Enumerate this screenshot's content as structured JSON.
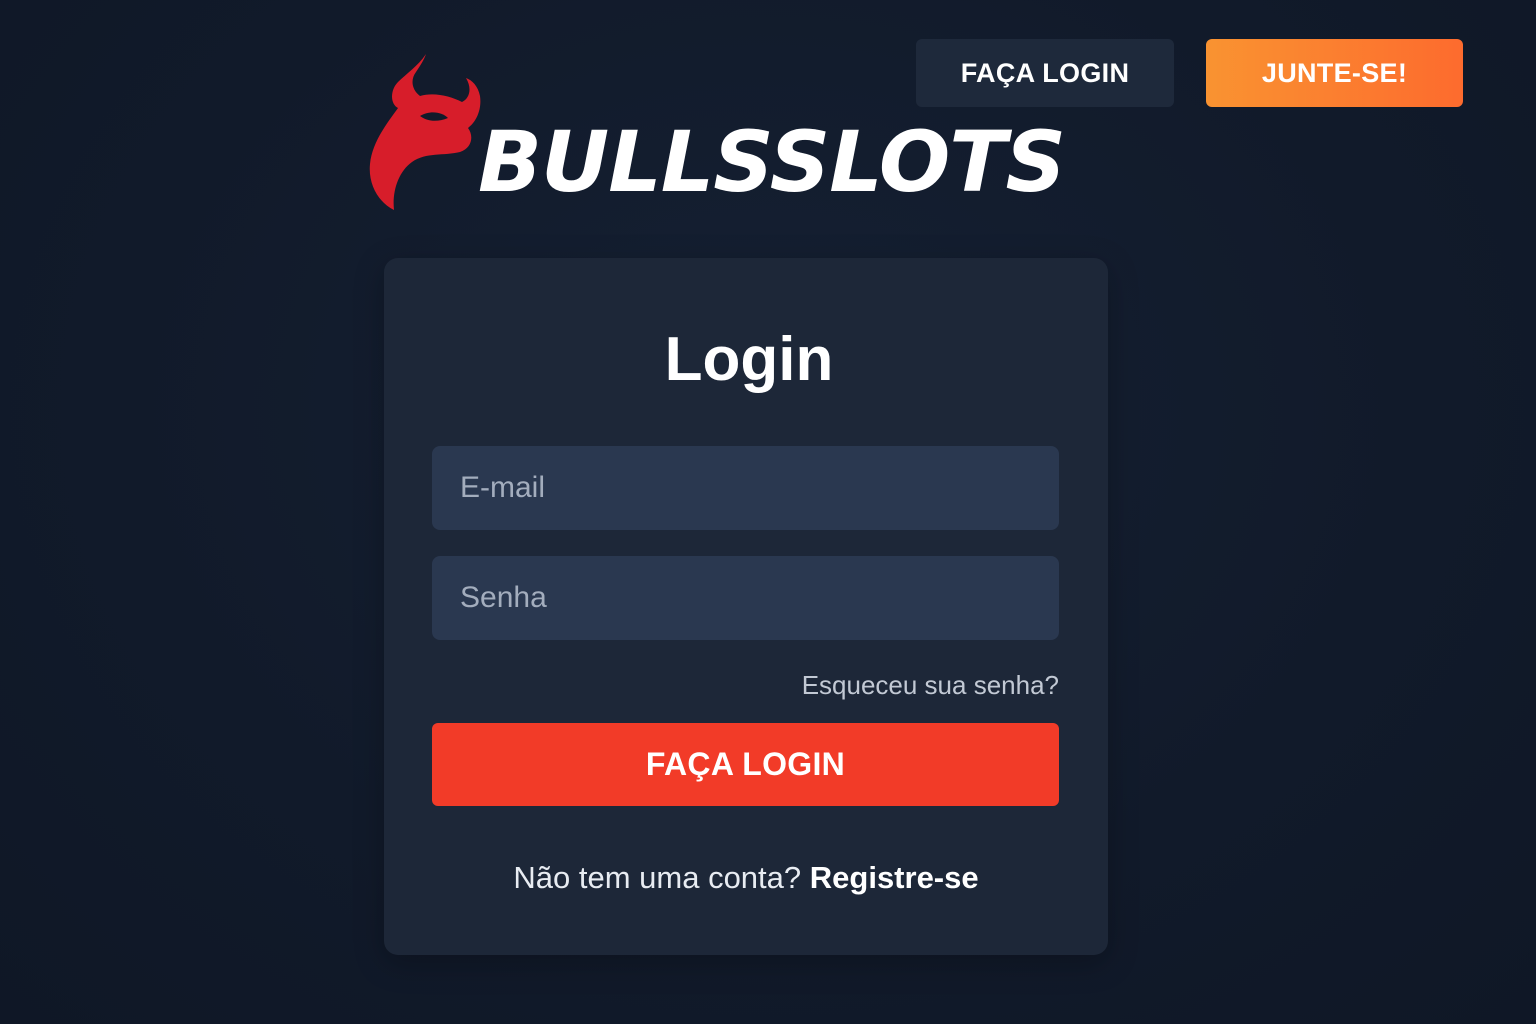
{
  "header": {
    "login_label": "FAÇA LOGIN",
    "join_label": "JUNTE-SE!"
  },
  "brand": {
    "name": "BULLSSLOTS",
    "logo_icon": "bull-head-icon"
  },
  "login_card": {
    "title": "Login",
    "email_placeholder": "E-mail",
    "email_value": "",
    "password_placeholder": "Senha",
    "password_value": "",
    "forgot_label": "Esqueceu sua senha?",
    "submit_label": "FAÇA LOGIN",
    "no_account_text": "Não tem uma conta?",
    "register_label": "Registre-se"
  },
  "colors": {
    "background": "#111a2a",
    "card": "#1d2738",
    "input": "#2a3850",
    "top_login_button": "#1e293b",
    "join_gradient_start": "#f99331",
    "join_gradient_end": "#fd6b2e",
    "submit_button": "#f23b28",
    "brand_red": "#d71d2a"
  }
}
